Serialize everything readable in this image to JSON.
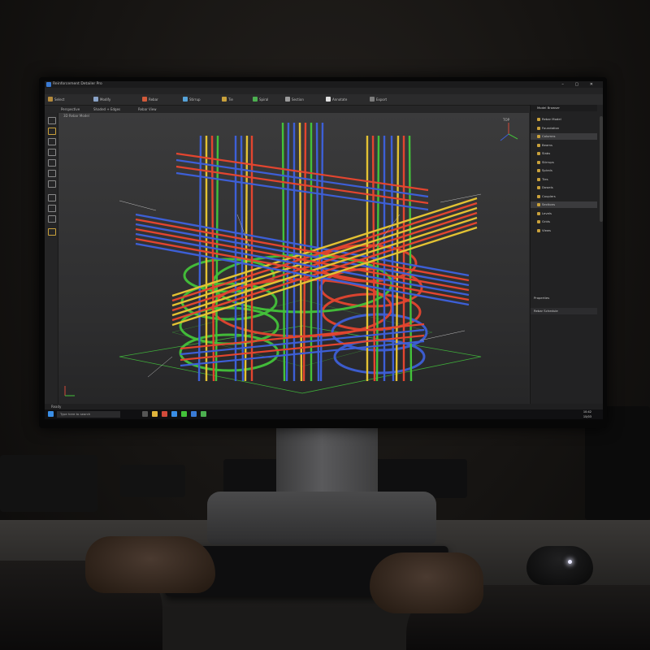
{
  "app": {
    "title": "Reinforcement Detailer Pro",
    "window_buttons": "– ▢ ✕",
    "menu": [
      "File",
      "Edit",
      "View",
      "Insert",
      "Modify",
      "Analysis",
      "Tools",
      "Window",
      "Help"
    ],
    "ribbon": [
      "Select",
      "Modify",
      "Rebar",
      "Stirrup",
      "Tie",
      "Spiral",
      "Section",
      "Annotate",
      "Export"
    ],
    "subbar": [
      "Perspective",
      "Shaded + Edges",
      "Rebar View"
    ],
    "viewport_label": "3D Rebar Model",
    "viewcube_label": "TOP"
  },
  "right_panel": {
    "header": "Model Browser",
    "items": [
      {
        "label": "Rebar Model",
        "selected": false
      },
      {
        "label": "Foundation",
        "selected": false
      },
      {
        "label": "Columns",
        "selected": true
      },
      {
        "label": "Beams",
        "selected": false
      },
      {
        "label": "Slabs",
        "selected": false
      },
      {
        "label": "Stirrups",
        "selected": false
      },
      {
        "label": "Spirals",
        "selected": false
      },
      {
        "label": "Ties",
        "selected": false
      },
      {
        "label": "Dowels",
        "selected": false
      },
      {
        "label": "Couplers",
        "selected": false
      },
      {
        "label": "Sections",
        "selected": true
      },
      {
        "label": "Levels",
        "selected": false
      },
      {
        "label": "Grids",
        "selected": false
      },
      {
        "label": "Views",
        "selected": false
      }
    ],
    "footer_1": "Properties",
    "footer_2": "Rebar Schedule"
  },
  "status": {
    "text": "Ready"
  },
  "taskbar": {
    "search_placeholder": "Type here to search",
    "time": "10:42",
    "date": "15/03"
  },
  "colors": {
    "rebar_red": "#e3452f",
    "rebar_blue": "#3d5fd6",
    "rebar_green": "#43c23a",
    "rebar_yellow": "#e3c233",
    "grid_green": "#3fae3a",
    "panel_accent": "#c9a13b"
  }
}
